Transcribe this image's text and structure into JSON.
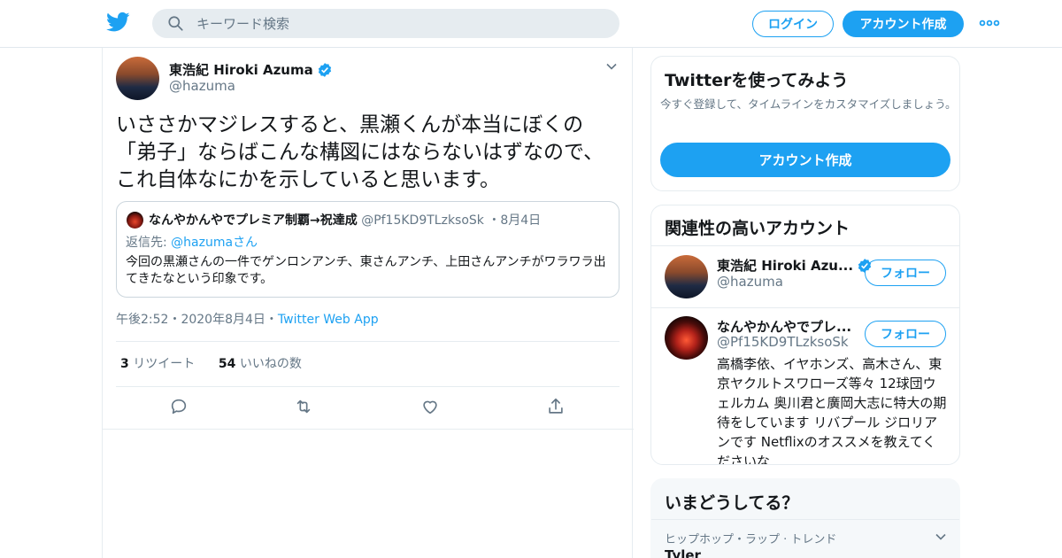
{
  "header": {
    "search_placeholder": "キーワード検索",
    "login_label": "ログイン",
    "signup_label": "アカウント作成"
  },
  "tweet": {
    "author_name": "東浩紀 Hiroki Azuma",
    "author_handle": "@hazuma",
    "text": "いささかマジレスすると、黒瀬くんが本当にぼくの「弟子」ならばこんな構図にはならないはずなので、これ自体なにかを示していると思います。",
    "quote": {
      "author_name": "なんやかんやでプレミア制覇→祝達成",
      "author_handle": "@Pf15KD9TLzksoSk",
      "separator": "・",
      "date": "8月4日",
      "reply_prefix": "返信先: ",
      "reply_to": "@hazumaさん",
      "text": "今回の黒瀬さんの一件でゲンロンアンチ、東さんアンチ、上田さんアンチがワラワラ出てきたなという印象です。"
    },
    "time": "午後2:52",
    "meta_separator": "・",
    "date": "2020年8月4日",
    "app": "Twitter Web App",
    "retweet_count": "3",
    "retweet_label": "リツイート",
    "like_count": "54",
    "like_label": "いいねの数"
  },
  "sidebar": {
    "signup_card": {
      "title": "Twitterを使ってみよう",
      "subtitle": "今すぐ登録して、タイムラインをカスタマイズしましょう。",
      "cta_label": "アカウント作成"
    },
    "related": {
      "title": "関連性の高いアカウント",
      "accounts": [
        {
          "name": "東浩紀 Hiroki Azu...",
          "handle": "@hazuma",
          "follow_label": "フォロー"
        },
        {
          "name": "なんやかんやでプレ...",
          "handle": "@Pf15KD9TLzksoSk",
          "follow_label": "フォロー",
          "bio": "高橋李依、イヤホンズ、高木さん、東京ヤクルトスワローズ等々 12球団ウェルカム 奥川君と廣岡大志に特大の期待をしています リバプール ジロリアンです Netflixのオススメを教えてくださいな"
        }
      ]
    },
    "trends": {
      "title": "いまどうしてる？",
      "items": [
        {
          "category": "ヒップホップ・ラップ · トレンド",
          "name": "Tyler"
        }
      ]
    }
  },
  "colors": {
    "accent": "#1da1f2",
    "text": "#14171a",
    "secondary_text": "#657786",
    "border": "#e6ecf0"
  }
}
